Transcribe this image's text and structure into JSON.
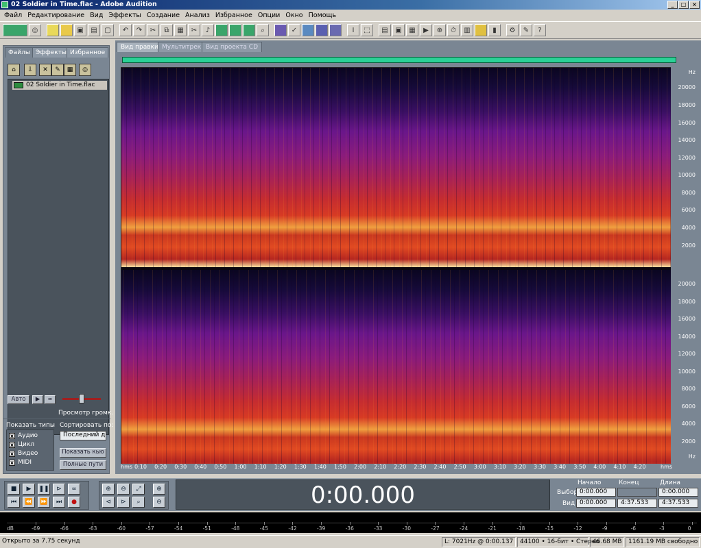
{
  "window": {
    "title": "02 Soldier in Time.flac - Adobe Audition"
  },
  "menubar": {
    "items": [
      "Файл",
      "Редактирование",
      "Вид",
      "Эффекты",
      "Создание",
      "Анализ",
      "Избранное",
      "Опции",
      "Окно",
      "Помощь"
    ]
  },
  "left_panel": {
    "tabs": [
      "Файлы",
      "Эффекты",
      "Избранное"
    ],
    "file": "02 Soldier in Time.flac",
    "auto_button": "Авто",
    "volume_label": "Просмотр громк.",
    "show_types_label": "Показать типы",
    "types": [
      "Аудио",
      "Цикл",
      "Видео",
      "MIDI"
    ],
    "sort_label": "Сортировать по:",
    "sort_value": "Последний д",
    "show_cue_button": "Показать кью",
    "full_paths_button": "Полные пути"
  },
  "main": {
    "tabs": [
      "Вид правки",
      "Мультитрек",
      "Вид проекта CD"
    ],
    "hz_unit": "Hz",
    "hz_ticks": [
      "20000",
      "18000",
      "16000",
      "14000",
      "12000",
      "10000",
      "8000",
      "6000",
      "4000",
      "2000"
    ],
    "time_unit": "hms",
    "time_ticks": [
      "0:10",
      "0:20",
      "0:30",
      "0:40",
      "0:50",
      "1:00",
      "1:10",
      "1:20",
      "1:30",
      "1:40",
      "1:50",
      "2:00",
      "2:10",
      "2:20",
      "2:30",
      "2:40",
      "2:50",
      "3:00",
      "3:10",
      "3:20",
      "3:30",
      "3:40",
      "3:50",
      "4:00",
      "4:10",
      "4:20"
    ]
  },
  "transport": {
    "time": "0:00.000",
    "headers": {
      "start": "Начало",
      "end": "Конец",
      "length": "Длина"
    },
    "rows": [
      {
        "label": "Выбор",
        "start": "0:00.000",
        "end": "",
        "length": "0:00.000"
      },
      {
        "label": "Вид",
        "start": "0:00.000",
        "end": "4:37.533",
        "length": "4:37.533"
      }
    ]
  },
  "meter": {
    "unit": "dB",
    "ticks": [
      "-69",
      "-66",
      "-63",
      "-60",
      "-57",
      "-54",
      "-51",
      "-48",
      "-45",
      "-42",
      "-39",
      "-36",
      "-33",
      "-30",
      "-27",
      "-24",
      "-21",
      "-18",
      "-15",
      "-12",
      "-9",
      "-6",
      "-3",
      "0"
    ]
  },
  "status": {
    "message": "Открыто за 7.75 секунд",
    "cursor": "L: 7021Hz @  0:00.137",
    "format": "44100 • 16-бит • Стерео",
    "size": "46.68 MB",
    "free": "1161.19 MB свободно"
  }
}
